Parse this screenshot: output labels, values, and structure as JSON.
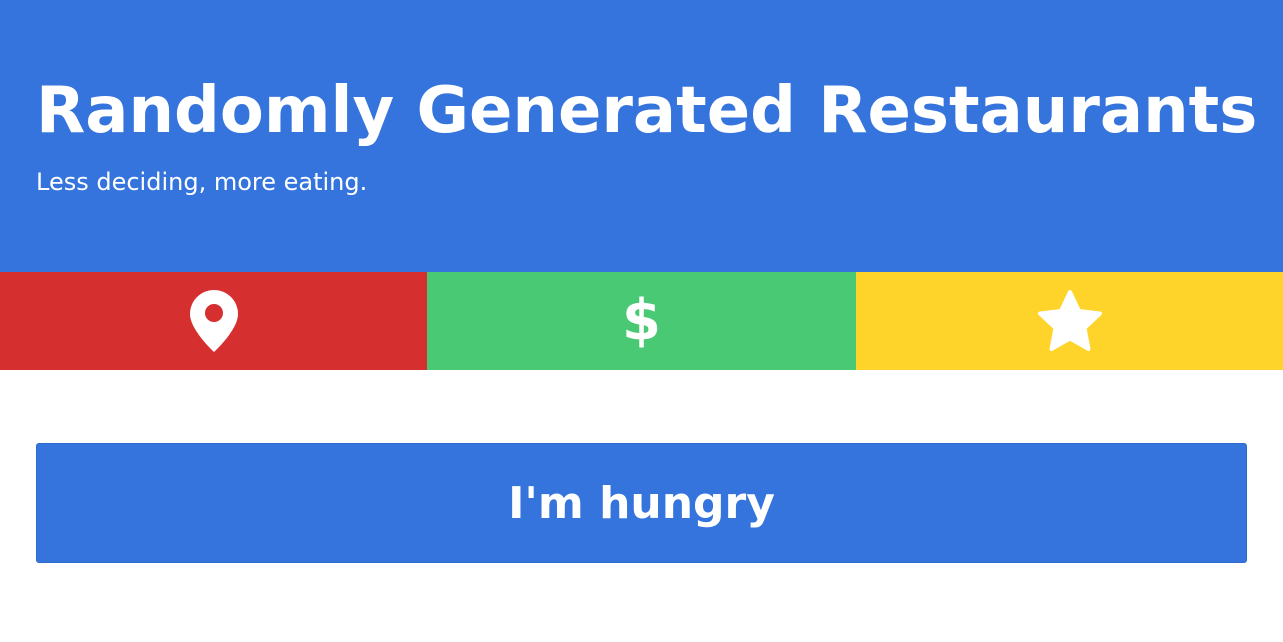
{
  "header": {
    "title": "Randomly Generated Restaurants",
    "subtitle": "Less deciding, more eating."
  },
  "filters": [
    {
      "name": "location",
      "icon": "map-marker-icon",
      "color": "#d62f2f"
    },
    {
      "name": "price",
      "icon": "dollar-icon",
      "glyph": "$",
      "color": "#4ac974"
    },
    {
      "name": "rating",
      "icon": "star-icon",
      "color": "#fed32a"
    }
  ],
  "action": {
    "label": "I'm hungry"
  },
  "colors": {
    "primary": "#3474dc",
    "red": "#d62f2f",
    "green": "#4ac974",
    "yellow": "#fed32a",
    "text_on_color": "#ffffff"
  }
}
